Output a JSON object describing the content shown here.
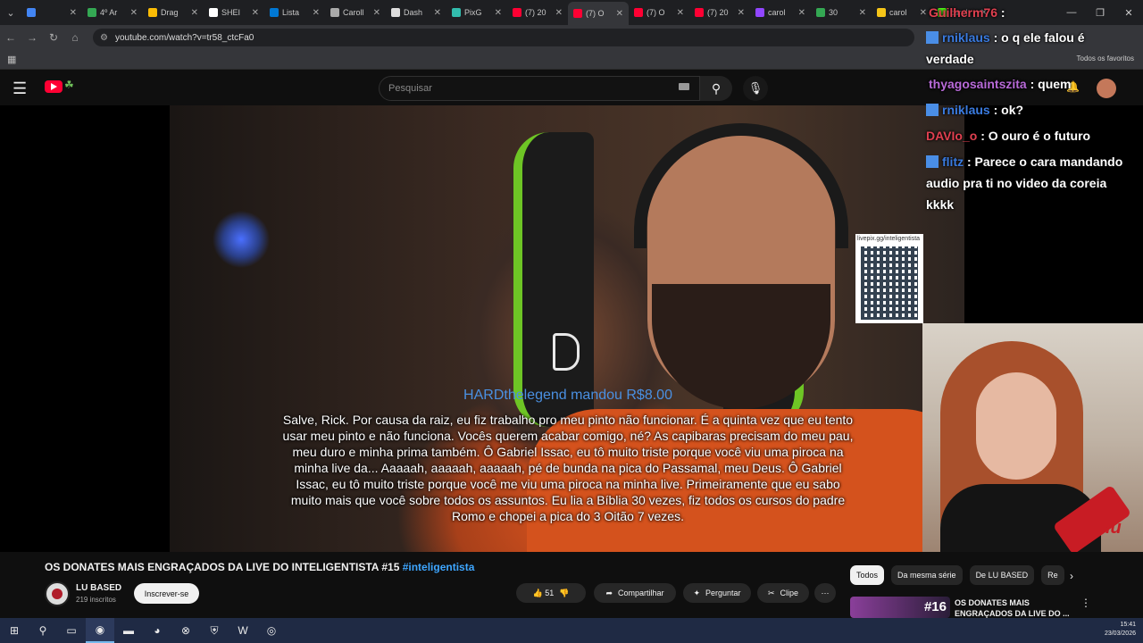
{
  "browser": {
    "tabs": [
      {
        "label": "",
        "color": "#4285f4"
      },
      {
        "label": "4º Ar",
        "color": "#34a853"
      },
      {
        "label": "Drag",
        "color": "#fbbc05"
      },
      {
        "label": "SHEI",
        "color": "#ffffff"
      },
      {
        "label": "Lista",
        "color": "#0078d4"
      },
      {
        "label": "Caroll",
        "color": "#aaaaaa"
      },
      {
        "label": "Dash",
        "color": "#dddddd"
      },
      {
        "label": "PixG",
        "color": "#32bcad"
      },
      {
        "label": "(7) 20",
        "color": "#ff0033"
      },
      {
        "label": "(7) O",
        "color": "#ff0033"
      },
      {
        "label": "(7) O",
        "color": "#ff0033"
      },
      {
        "label": "(7) 20",
        "color": "#ff0033"
      },
      {
        "label": "carol",
        "color": "#9146ff"
      },
      {
        "label": "30",
        "color": "#34a853"
      },
      {
        "label": "carol",
        "color": "#f5c518"
      },
      {
        "label": "carol",
        "color": "#53fc18"
      }
    ],
    "url": "youtube.com/watch?v=tr58_ctcFa0",
    "all_bookmarks": "Todos os favoritos"
  },
  "youtube": {
    "search_placeholder": "Pesquisar"
  },
  "video": {
    "donation_title": "HARDthelegend mandou R$8.00",
    "donation_text": "Salve, Rick. Por causa da raiz, eu fiz trabalho pro meu pinto não funcionar. É a quinta vez que eu tento usar meu pinto e não funciona. Vocês querem acabar comigo, né? As capibaras precisam do meu pau, meu duro e minha prima também. Ô Gabriel Issac, eu tô muito triste porque você viu uma piroca na minha live da... Aaaaah, aaaaah, aaaaah, pé de bunda na pica do Passamal, meu Deus. Ô Gabriel Issac, eu tô muito triste porque você me viu uma piroca na minha live. Primeiramente que eu sabo muito mais que você sobre todos os assuntos. Eu lia a Bíblia 30 vezes, fiz todos os cursos do padre Romo e chopei a pica do 3 Oitão 7 vezes.",
    "qr_url": "livepix.gg/inteligentista",
    "chat": [
      {
        "user": "Guilherm76",
        "text": ":",
        "color": "#e04050"
      },
      {
        "user": "rniklaus",
        "text": ": o q ele falou é",
        "color": "#3a7be0"
      },
      {
        "user": "",
        "text": "verdade",
        "color": "#ffffff"
      },
      {
        "user": "thyagosaintszita",
        "text": ": quem",
        "color": "#b86ad8"
      },
      {
        "user": "rniklaus",
        "text": ": ok?",
        "color": "#3a7be0"
      },
      {
        "user": "DAVIo_o",
        "text": ": O ouro é o futuro",
        "color": "#e04050"
      },
      {
        "user": "flitz",
        "text": ": Parece o cara mandando",
        "color": "#3a7be0"
      },
      {
        "user": "",
        "text": "audio pra ti no video da coreia",
        "color": "#ffffff"
      },
      {
        "user": "",
        "text": "kkkk",
        "color": "#ffffff"
      }
    ]
  },
  "info": {
    "title": "OS DONATES MAIS ENGRAÇADOS DA LIVE DO INTELIGENTISTA #15",
    "hashtag": "#inteligentista",
    "channel": "LU BASED",
    "subs": "219 inscritos",
    "subscribe": "Inscrever-se",
    "likes": "51",
    "share": "Compartilhar",
    "ask": "Perguntar",
    "clip": "Clipe",
    "chips": [
      "Todos",
      "Da mesma série",
      "De LU BASED",
      "Re"
    ],
    "rec": {
      "num": "#16",
      "title": "OS DONATES MAIS ENGRAÇADOS DA LIVE DO ..."
    }
  },
  "taskbar": {
    "time": "15:41",
    "date": "23/03/2026"
  }
}
